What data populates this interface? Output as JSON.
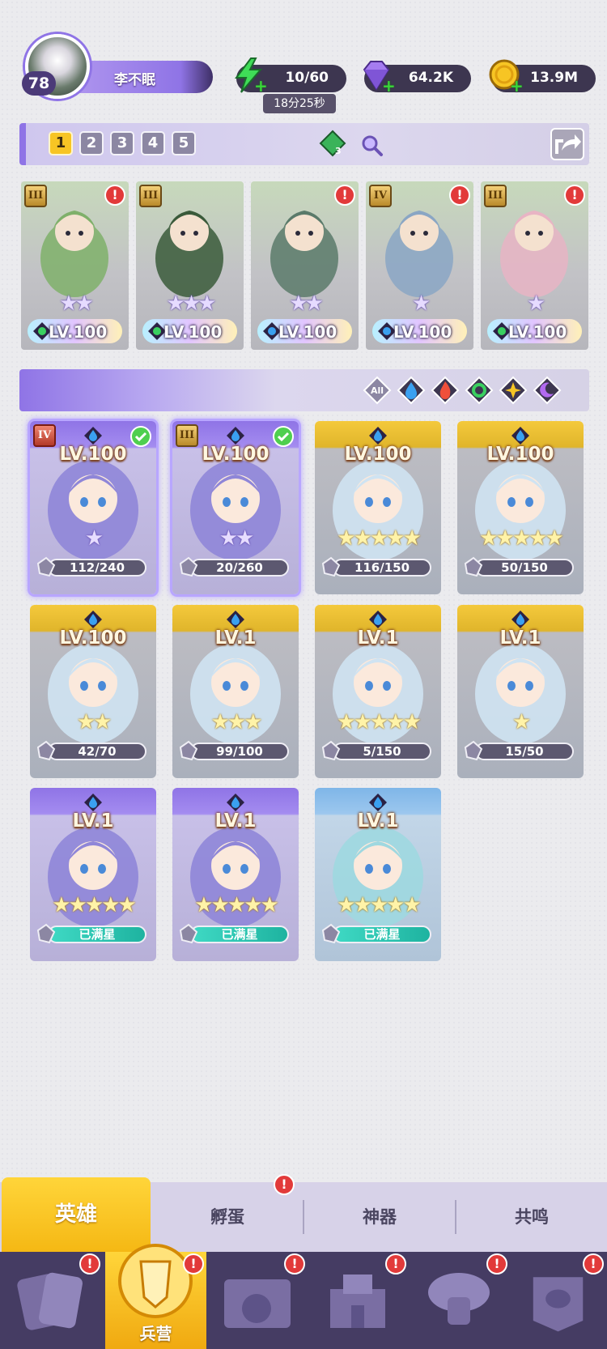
{
  "player": {
    "level": "78",
    "name": "李不眠"
  },
  "resources": {
    "energy": {
      "value": "10/60",
      "timer": "18分25秒",
      "icon": "lightning-icon"
    },
    "gems": {
      "value": "64.2K",
      "icon": "diamond-icon"
    },
    "coins": {
      "value": "13.9M",
      "icon": "coin-icon"
    }
  },
  "team": {
    "slots": [
      "1",
      "2",
      "3",
      "4",
      "5"
    ],
    "active_slot": 0,
    "gem_badge_count": "3"
  },
  "team_cards": [
    {
      "rank": "III",
      "level": "LV.100",
      "stars": "★★",
      "element": "wind",
      "alert": "!",
      "art": "#7fb06a"
    },
    {
      "rank": "III",
      "level": "LV.100",
      "stars": "★★★",
      "element": "wind",
      "alert": "",
      "art": "#3a5a3a"
    },
    {
      "rank": "",
      "level": "LV.100",
      "stars": "★★",
      "element": "water",
      "alert": "!",
      "art": "#5a7a6a"
    },
    {
      "rank": "IV",
      "level": "LV.100",
      "stars": "★",
      "element": "water",
      "alert": "!",
      "art": "#8aa6c4"
    },
    {
      "rank": "III",
      "level": "LV.100",
      "stars": "★",
      "element": "wind",
      "alert": "!",
      "art": "#e8b4c4"
    }
  ],
  "filters": {
    "all_label": "All",
    "items": [
      "all",
      "water",
      "fire",
      "wind",
      "light",
      "dark"
    ]
  },
  "heroes": [
    {
      "level": "LV.100",
      "progress": "112/240",
      "stars": "★",
      "style": "purple",
      "selected": true,
      "rank": "IV",
      "rank_red": true,
      "check": true
    },
    {
      "level": "LV.100",
      "progress": "20/260",
      "stars": "★★",
      "style": "purple",
      "selected": true,
      "rank": "III",
      "check": true
    },
    {
      "level": "LV.100",
      "progress": "116/150",
      "stars": "★★★★★",
      "style": "gold"
    },
    {
      "level": "LV.100",
      "progress": "50/150",
      "stars": "★★★★★",
      "style": "gold"
    },
    {
      "level": "LV.100",
      "progress": "42/70",
      "stars": "★★",
      "style": "gold"
    },
    {
      "level": "LV.1",
      "progress": "99/100",
      "stars": "★★★",
      "style": "gold"
    },
    {
      "level": "LV.1",
      "progress": "5/150",
      "stars": "★★★★★",
      "style": "gold"
    },
    {
      "level": "LV.1",
      "progress": "15/50",
      "stars": "★",
      "style": "gold"
    },
    {
      "level": "LV.1",
      "progress": "已满星",
      "stars": "★★★★★",
      "style": "purple",
      "full": true
    },
    {
      "level": "LV.1",
      "progress": "已满星",
      "stars": "★★★★★",
      "style": "purple",
      "full": true
    },
    {
      "level": "LV.1",
      "progress": "已满星",
      "stars": "★★★★★",
      "style": "blue",
      "full": true
    }
  ],
  "subtabs": {
    "heroes": "英雄",
    "hatch": "孵蛋",
    "artifact": "神器",
    "resonance": "共鸣"
  },
  "nav": {
    "barracks": "兵营"
  },
  "colors": {
    "accent": "#8f74e6",
    "gold": "#f5b814",
    "alert": "#e23a3a",
    "nav": "#453c63"
  }
}
